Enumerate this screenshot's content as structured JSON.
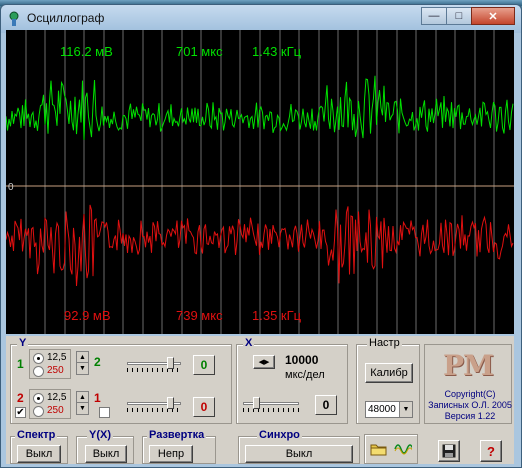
{
  "window": {
    "title": "Осциллограф",
    "buttons": {
      "minimize": "—",
      "maximize": "□",
      "close": "✕"
    }
  },
  "scope": {
    "channel1": {
      "amplitude": "116.2 мВ",
      "period": "701 мкс",
      "frequency": "1.43 кГц",
      "color": "#00e000"
    },
    "channel2": {
      "amplitude": "92.9 мВ",
      "period": "739 мкс",
      "frequency": "1.35 кГц",
      "color": "#e01010"
    },
    "zero_label": "0",
    "colors": {
      "background": "#000000",
      "grid": "#6b6b6b",
      "zero_line": "#c8a080"
    }
  },
  "controls": {
    "y_group": {
      "title": "Y",
      "ch1": {
        "number": "1",
        "side_number": "2",
        "options": [
          "12,5",
          "250"
        ],
        "selected": "12,5",
        "offset": "0"
      },
      "ch2": {
        "number": "2",
        "side_number": "1",
        "options": [
          "12,5",
          "250"
        ],
        "selected": "12,5",
        "offset": "0",
        "enabled": "✔"
      }
    },
    "x_group": {
      "title": "X",
      "value": "10000",
      "unit": "мкс/дел",
      "offset": "0"
    },
    "settings_group": {
      "title": "Настр",
      "calibrate": "Калибр",
      "sample_rate": "48000"
    },
    "logo": {
      "text": "PM",
      "copyright_lines": [
        "Copyright(C)",
        "Записных О.Л. 2005",
        "Версия 1.22"
      ]
    },
    "spectrum": {
      "title": "Спектр",
      "button": "Выкл"
    },
    "yx": {
      "title": "Y(X)",
      "button": "Выкл"
    },
    "sweep": {
      "title": "Развертка",
      "button": "Непр"
    },
    "sync": {
      "title": "Синхро",
      "button": "Выкл"
    },
    "toolbar": {
      "open_icon": "folder-icon",
      "wave_icon": "wave-icon",
      "save_icon": "floppy-icon",
      "help": "?"
    }
  }
}
